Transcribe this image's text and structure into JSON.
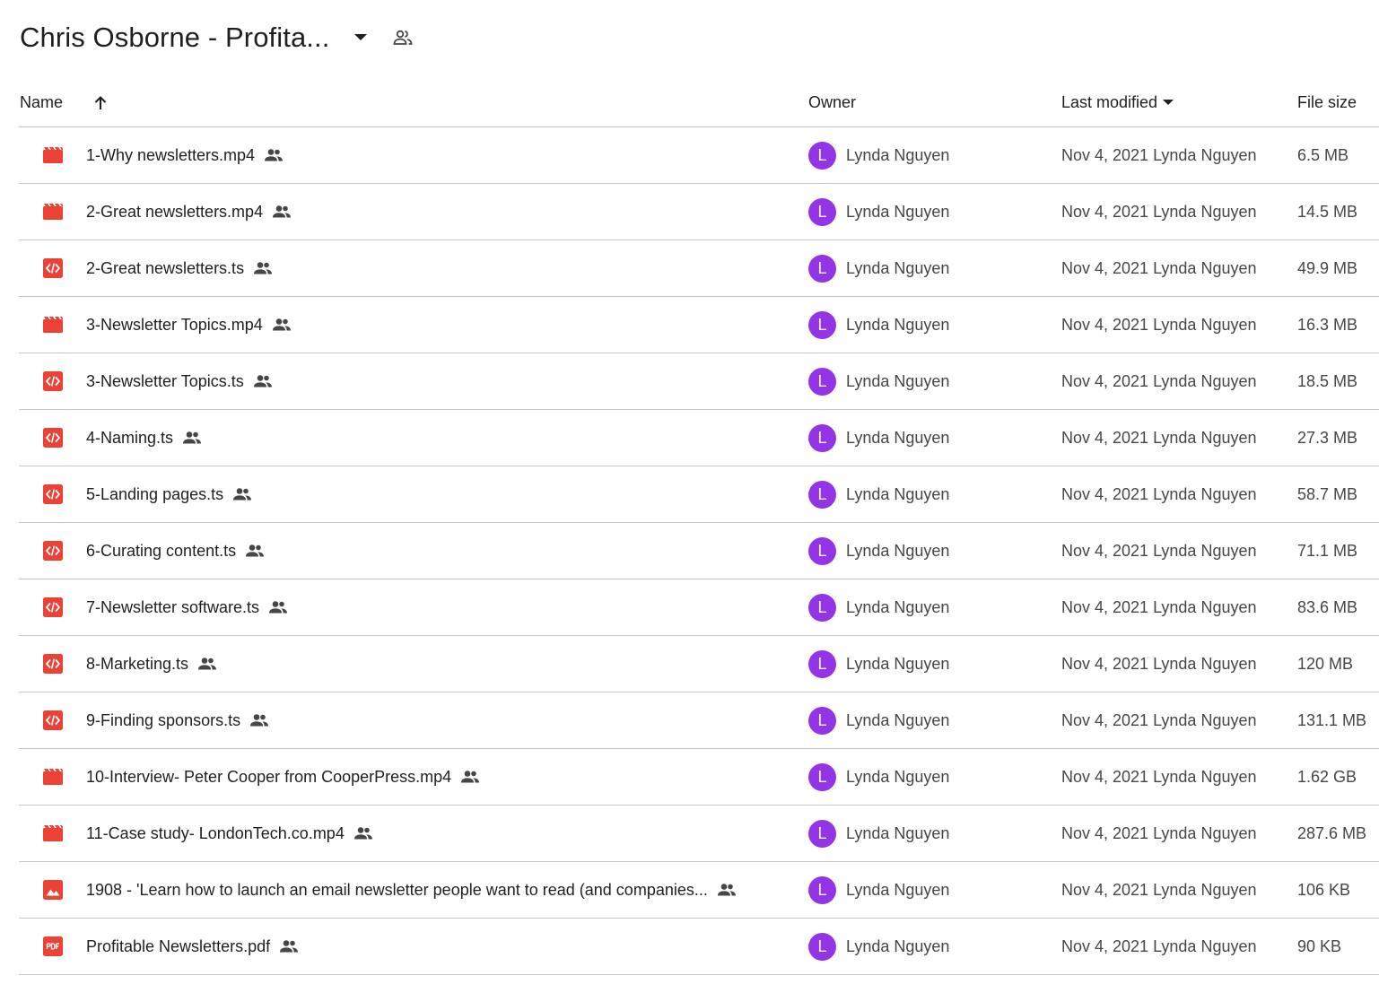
{
  "folder": {
    "title": "Chris Osborne - Profita...",
    "dropdown_icon": "caret-down-icon",
    "share_icon": "people-outline-icon"
  },
  "columns": {
    "name": "Name",
    "owner": "Owner",
    "last_modified": "Last modified",
    "file_size": "File size",
    "sort_icon": "arrow-up-icon"
  },
  "colors": {
    "video": "#ea4335",
    "code": "#ea4335",
    "image": "#ea4335",
    "pdf": "#ea4335",
    "avatar": "#9334e6"
  },
  "files": [
    {
      "icon": "video",
      "name": "1-Why newsletters.mp4",
      "owner_initial": "L",
      "owner": "Lynda Nguyen",
      "modified": "Nov 4, 2021 Lynda Nguyen",
      "size": "6.5 MB"
    },
    {
      "icon": "video",
      "name": "2-Great newsletters.mp4",
      "owner_initial": "L",
      "owner": "Lynda Nguyen",
      "modified": "Nov 4, 2021 Lynda Nguyen",
      "size": "14.5 MB"
    },
    {
      "icon": "code",
      "name": "2-Great newsletters.ts",
      "owner_initial": "L",
      "owner": "Lynda Nguyen",
      "modified": "Nov 4, 2021 Lynda Nguyen",
      "size": "49.9 MB"
    },
    {
      "icon": "video",
      "name": "3-Newsletter Topics.mp4",
      "owner_initial": "L",
      "owner": "Lynda Nguyen",
      "modified": "Nov 4, 2021 Lynda Nguyen",
      "size": "16.3 MB"
    },
    {
      "icon": "code",
      "name": "3-Newsletter Topics.ts",
      "owner_initial": "L",
      "owner": "Lynda Nguyen",
      "modified": "Nov 4, 2021 Lynda Nguyen",
      "size": "18.5 MB"
    },
    {
      "icon": "code",
      "name": "4-Naming.ts",
      "owner_initial": "L",
      "owner": "Lynda Nguyen",
      "modified": "Nov 4, 2021 Lynda Nguyen",
      "size": "27.3 MB"
    },
    {
      "icon": "code",
      "name": "5-Landing pages.ts",
      "owner_initial": "L",
      "owner": "Lynda Nguyen",
      "modified": "Nov 4, 2021 Lynda Nguyen",
      "size": "58.7 MB"
    },
    {
      "icon": "code",
      "name": "6-Curating content.ts",
      "owner_initial": "L",
      "owner": "Lynda Nguyen",
      "modified": "Nov 4, 2021 Lynda Nguyen",
      "size": "71.1 MB"
    },
    {
      "icon": "code",
      "name": "7-Newsletter software.ts",
      "owner_initial": "L",
      "owner": "Lynda Nguyen",
      "modified": "Nov 4, 2021 Lynda Nguyen",
      "size": "83.6 MB"
    },
    {
      "icon": "code",
      "name": "8-Marketing.ts",
      "owner_initial": "L",
      "owner": "Lynda Nguyen",
      "modified": "Nov 4, 2021 Lynda Nguyen",
      "size": "120 MB"
    },
    {
      "icon": "code",
      "name": "9-Finding sponsors.ts",
      "owner_initial": "L",
      "owner": "Lynda Nguyen",
      "modified": "Nov 4, 2021 Lynda Nguyen",
      "size": "131.1 MB"
    },
    {
      "icon": "video",
      "name": "10-Interview- Peter Cooper from CooperPress.mp4",
      "owner_initial": "L",
      "owner": "Lynda Nguyen",
      "modified": "Nov 4, 2021 Lynda Nguyen",
      "size": "1.62 GB"
    },
    {
      "icon": "video",
      "name": "11-Case study- LondonTech.co.mp4",
      "owner_initial": "L",
      "owner": "Lynda Nguyen",
      "modified": "Nov 4, 2021 Lynda Nguyen",
      "size": "287.6 MB"
    },
    {
      "icon": "image",
      "name": "1908 - 'Learn how to launch an email newsletter people want to read (and companies...",
      "owner_initial": "L",
      "owner": "Lynda Nguyen",
      "modified": "Nov 4, 2021 Lynda Nguyen",
      "size": "106 KB"
    },
    {
      "icon": "pdf",
      "name": "Profitable Newsletters.pdf",
      "owner_initial": "L",
      "owner": "Lynda Nguyen",
      "modified": "Nov 4, 2021 Lynda Nguyen",
      "size": "90 KB"
    }
  ]
}
